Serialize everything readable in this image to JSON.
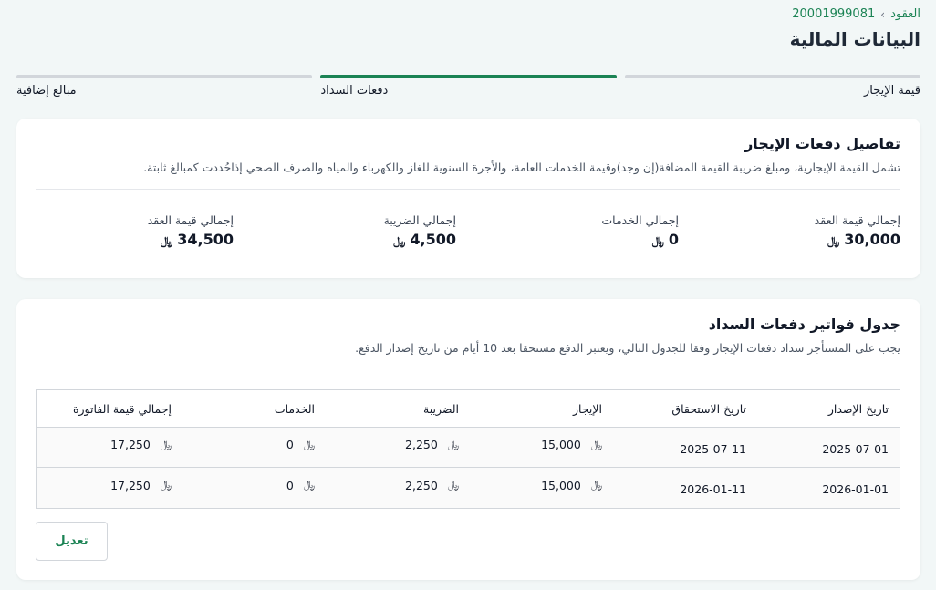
{
  "breadcrumb": {
    "root": "العقود",
    "current": "20001999081"
  },
  "page_title": "البيانات المالية",
  "steps": [
    {
      "label": "قيمة الإيجار"
    },
    {
      "label": "دفعات السداد"
    },
    {
      "label": "مبالغ إضافية"
    }
  ],
  "rent_details": {
    "title": "تفاصيل دفعات الإيجار",
    "description": "تشمل القيمة الإيجارية، ومبلغ ضريبة القيمة المضافة(إن وجد)وقيمة الخدمات العامة، والأجرة السنوية للغاز والكهرباء والمياه والصرف الصحي إذاحُددت كمبالغ ثابتة.",
    "currency": "﷼",
    "stats": [
      {
        "label": "إجمالي قيمة العقد",
        "value": "30,000"
      },
      {
        "label": "إجمالي الخدمات",
        "value": "0"
      },
      {
        "label": "إجمالي الضريبة",
        "value": "4,500"
      },
      {
        "label": "إجمالي قيمة العقد",
        "value": "34,500"
      }
    ]
  },
  "schedule": {
    "title": "جدول فواتير دفعات السداد",
    "description": "يجب على المستأجر سداد دفعات الإيجار وفقا للجدول التالي، ويعتبر الدفع مستحقا بعد 10 أيام من تاريخ إصدار الدفع.",
    "currency": "﷼",
    "columns": [
      "تاريخ الإصدار",
      "تاريخ الاستحقاق",
      "الإيجار",
      "الضريبة",
      "الخدمات",
      "إجمالي قيمة الفاتورة"
    ],
    "rows": [
      {
        "issue": "2025-07-01",
        "due": "2025-07-11",
        "rent": "15,000",
        "tax": "2,250",
        "services": "0",
        "total": "17,250"
      },
      {
        "issue": "2026-01-01",
        "due": "2026-01-11",
        "rent": "15,000",
        "tax": "2,250",
        "services": "0",
        "total": "17,250"
      }
    ],
    "edit_label": "تعديل"
  },
  "colors": {
    "accent": "#1b8354",
    "background": "#f2f7f7"
  }
}
